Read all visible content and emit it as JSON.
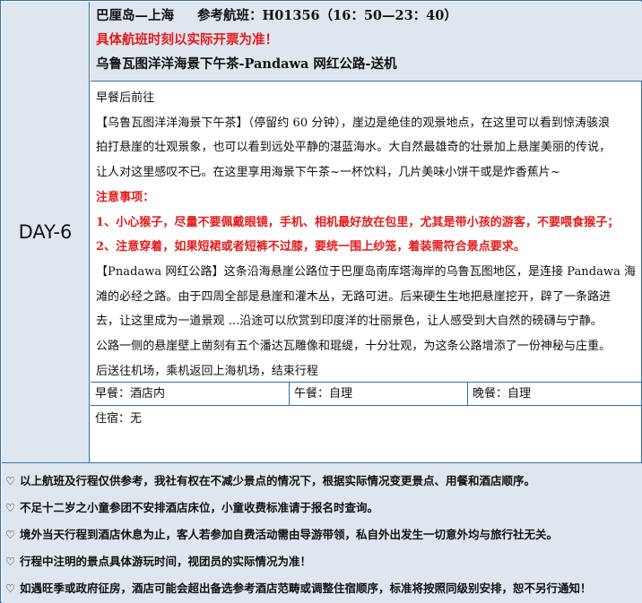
{
  "day": "DAY-6",
  "flight": {
    "route": "巴厘岛—上海",
    "reference": "参考航班：H01356（16：50—23：40）",
    "notice": "具体航班时刻以实际开票为准！",
    "itinerary_title": "乌鲁瓦图洋洋海景下午茶-Pandawa 网红公路-送机"
  },
  "body": {
    "lines": [
      "早餐后前往",
      "【乌鲁瓦图洋洋海景下午茶】（停留约 60 分钟），崖边是绝佳的观景地点，在这里可以看到惊涛骇浪",
      "拍打悬崖的壮观景象，也可以看到远处平静的湛蓝海水。大自然最雄奇的壮景加上悬崖美丽的传说，",
      "让人对这里感叹不已。在这里享用海景下午茶~一杯饮料，几片美味小饼干或是炸香蕉片~",
      "注意事项：",
      "1、小心猴子，尽量不要佩戴眼镜，手机、相机最好放在包里，尤其是带小孩的游客，不要喂食猴子；",
      "2、注意穿着，如果短裙或者短裤不过膝，要统一围上纱笼，着装需符合景点要求。",
      "【Pnadawa 网红公路】这条沿海悬崖公路位于巴厘岛南库塔海岸的乌鲁瓦图地区，是连接 Pandawa 海",
      "滩的必经之路。由于四周全部是悬崖和灌木丛，无路可进。后来硬生生地把悬崖挖开，辟了一条路进",
      "去，让这里成为一道景观 ...沿途可以欣赏到印度洋的壮丽景色，让人感受到大自然的磅礴与宁静。",
      "公路一侧的悬崖壁上凿刻有五个潘达瓦雕像和琨缇，十分壮观，为这条公路增添了一份神秘与庄重。",
      "后送往机场，乘机返回上海机场，结束行程"
    ]
  },
  "meals": {
    "breakfast": "早餐：酒店内",
    "lunch": "午餐：自理",
    "dinner": "晚餐：自理"
  },
  "lodging": "住宿：无",
  "notes": [
    "以上航班及行程仅供参考，我社有权在不减少景点的情况下，根据实际情况变更景点、用餐和酒店顺序。",
    "不足十二岁之小童参团不安排酒店床位，小童收费标准请于报名时查询。",
    "境外当天行程到酒店休息为止，客人若参加自费活动需由导游带领，私自外出发生一切意外均与旅行社无关。",
    "行程中注明的景点具体游玩时间，视团员的实际情况为准！",
    "如遇旺季或政府征房，酒店可能会超出备选参考酒店范畴或调整住宿顺序，标准将按照同级别安排，恕不另行通知！"
  ],
  "colors": {
    "border": "#2f6fad",
    "header_bg": "#dfe6ef",
    "alert": "#e31b1b"
  }
}
